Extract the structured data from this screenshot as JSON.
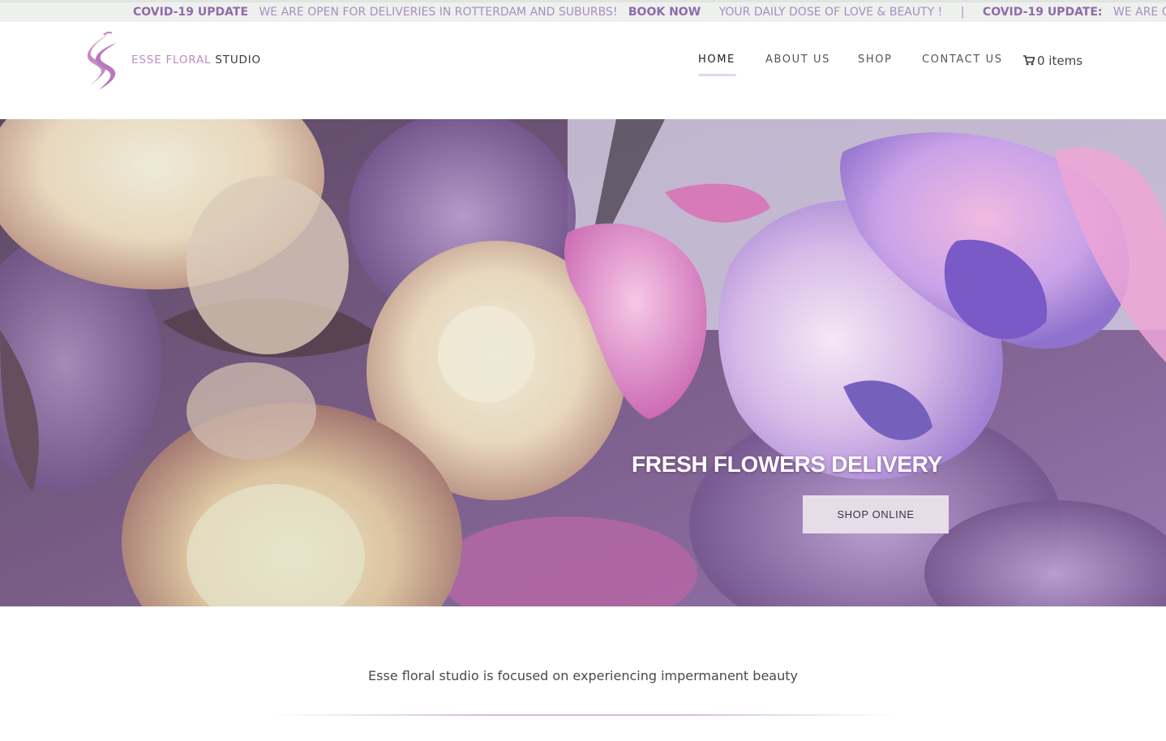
{
  "ticker": {
    "covid_label": "COVID-19 UPDATE",
    "message": "WE ARE OPEN FOR DELIVERIES IN ROTTERDAM AND SUBURBS!",
    "book_now": "BOOK NOW",
    "daily_dose": "YOUR DAILY DOSE OF LOVE & BEAUTY !",
    "separator": "|",
    "covid_label_2": "COVID-19 UPDATE:",
    "message_2": "WE ARE OPE"
  },
  "brand": {
    "part1": "ESSE FLORAL",
    "part2": "STUDIO"
  },
  "nav": {
    "items": [
      {
        "label": "HOME",
        "active": true
      },
      {
        "label": "ABOUT US",
        "active": false
      },
      {
        "label": "SHOP",
        "active": false
      },
      {
        "label": "CONTACT US",
        "active": false
      }
    ],
    "cart_label": "0 items",
    "cart_icon": "shopping-cart-icon"
  },
  "hero": {
    "title": "FRESH FLOWERS DELIVERY",
    "button": "SHOP ONLINE"
  },
  "intro": {
    "tagline": "Esse floral studio is focused on experiencing impermanent beauty"
  },
  "colors": {
    "accent": "#9b7fb6",
    "brand_pink": "#b98dc4",
    "button_bg": "#e6dde9"
  }
}
